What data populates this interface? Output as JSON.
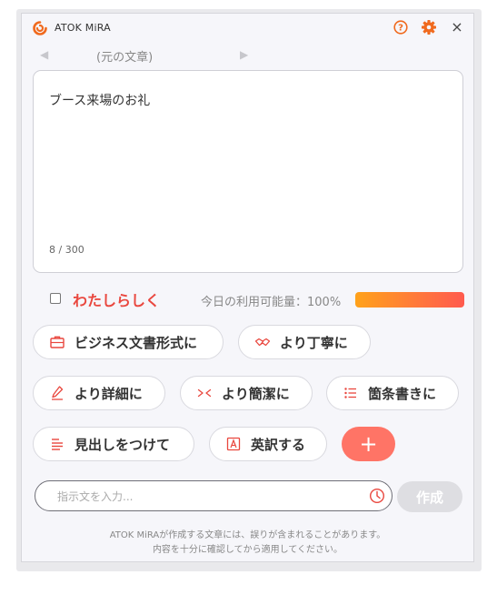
{
  "app": {
    "title": "ATOK MiRA",
    "close_glyph": "×"
  },
  "nav": {
    "label": "(元の文章)"
  },
  "editor": {
    "text": "ブース来場のお礼",
    "count": "8 / 300"
  },
  "options": {
    "watashi_label": "わたしらしく",
    "usage_text": "今日の利用可能量：100%",
    "usage_percent": 100
  },
  "actions": {
    "business": "ビジネス文書形式に",
    "polite": "より丁寧に",
    "detailed": "より詳細に",
    "concise": "より簡潔に",
    "bullets": "箇条書きに",
    "heading": "見出しをつけて",
    "translate": "英訳する",
    "add": "+"
  },
  "prompt": {
    "placeholder": "指示文を入力...",
    "create_label": "作成"
  },
  "disclaimer": {
    "line1": "ATOK MiRAが作成する文章には、誤りが含まれることがあります。",
    "line2": "内容を十分に確認してから適用してください。"
  },
  "colors": {
    "accent": "#ff7466",
    "brand_red": "#e9473e",
    "icon_orange": "#f06a1e"
  },
  "icons": [
    "mira-logo-icon",
    "help-icon",
    "gear-icon",
    "close-icon",
    "prev-arrow-icon",
    "next-arrow-icon",
    "briefcase-icon",
    "handshake-icon",
    "pen-icon",
    "shrink-icon",
    "list-icon",
    "heading-icon",
    "translate-icon",
    "clock-icon"
  ]
}
